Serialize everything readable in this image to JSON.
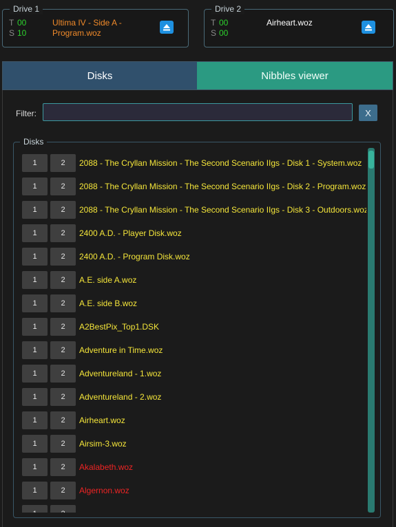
{
  "drive1": {
    "legend": "Drive 1",
    "track_label": "T",
    "track_value": "00",
    "sector_label": "S",
    "sector_value": "10",
    "disk_name": "Ultima IV - Side A - Program.woz",
    "eject_icon": "eject-icon"
  },
  "drive2": {
    "legend": "Drive 2",
    "track_label": "T",
    "track_value": "00",
    "sector_label": "S",
    "sector_value": "00",
    "disk_name": "Airheart.woz",
    "eject_icon": "eject-icon"
  },
  "tabs": {
    "disks": "Disks",
    "nibbles": "Nibbles viewer",
    "selected": "Nibbles viewer"
  },
  "filter": {
    "label": "Filter:",
    "value": "",
    "clear_label": "X"
  },
  "disks": {
    "legend": "Disks",
    "slot1_label": "1",
    "slot2_label": "2",
    "items": [
      {
        "name": "2088 - The Cryllan Mission - The Second Scenario IIgs - Disk 1 - System.woz",
        "color": "#f5e63a"
      },
      {
        "name": "2088 - The Cryllan Mission - The Second Scenario IIgs - Disk 2 - Program.woz",
        "color": "#f5e63a"
      },
      {
        "name": "2088 - The Cryllan Mission - The Second Scenario IIgs - Disk 3 - Outdoors.woz",
        "color": "#f5e63a"
      },
      {
        "name": "2400 A.D. - Player Disk.woz",
        "color": "#f5e63a"
      },
      {
        "name": "2400 A.D. - Program Disk.woz",
        "color": "#f5e63a"
      },
      {
        "name": "A.E. side A.woz",
        "color": "#f5e63a"
      },
      {
        "name": "A.E. side B.woz",
        "color": "#f5e63a"
      },
      {
        "name": "A2BestPix_Top1.DSK",
        "color": "#f5e63a"
      },
      {
        "name": "Adventure in Time.woz",
        "color": "#f5e63a"
      },
      {
        "name": "Adventureland - 1.woz",
        "color": "#f5e63a"
      },
      {
        "name": "Adventureland - 2.woz",
        "color": "#f5e63a"
      },
      {
        "name": "Airheart.woz",
        "color": "#f5e63a"
      },
      {
        "name": "Airsim-3.woz",
        "color": "#f5e63a"
      },
      {
        "name": "Akalabeth.woz",
        "color": "#ee2424"
      },
      {
        "name": "Algernon.woz",
        "color": "#ee2424"
      },
      {
        "name": "",
        "color": "#ee2424"
      }
    ]
  },
  "colors": {
    "track_sector_value": "#2dd12d",
    "drive1_name": "#f08a2a",
    "drive2_name": "#ffffff",
    "eject_button": "#1e90e0",
    "tab_disks": "#30506c",
    "tab_nibbles": "#2b9a82",
    "filter_clear": "#3d6d8c"
  }
}
